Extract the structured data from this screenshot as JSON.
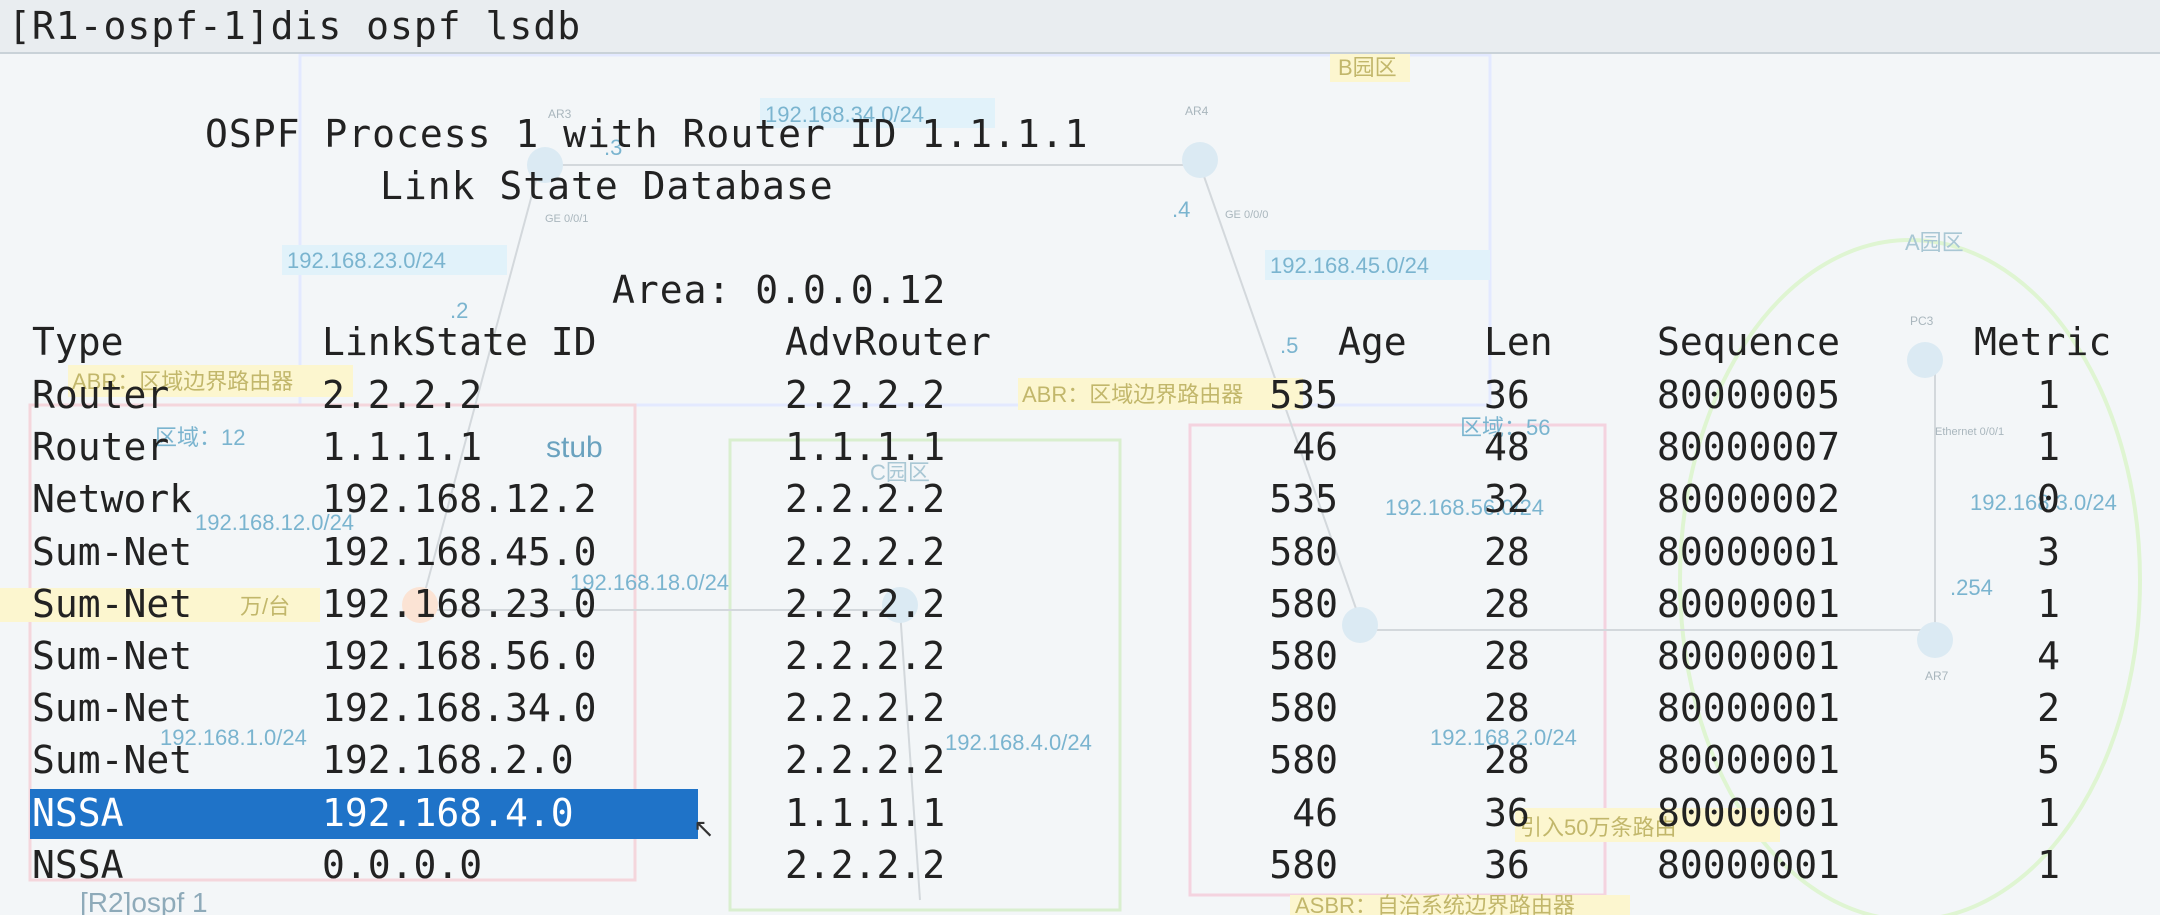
{
  "terminal": {
    "command": "[R1-ospf-1]dis ospf lsdb",
    "header_line1": "OSPF Process 1 with Router ID 1.1.1.1",
    "header_line2": "Link State Database",
    "area_line": "Area: 0.0.0.12"
  },
  "table": {
    "headers": {
      "type": "Type",
      "link_state_id": "LinkState ID",
      "adv_router": "AdvRouter",
      "age": "Age",
      "len": "Len",
      "sequence": "Sequence",
      "metric": "Metric"
    },
    "rows": [
      {
        "type": "Router",
        "lsid": "2.2.2.2",
        "adv": "2.2.2.2",
        "age": "535",
        "len": "36",
        "seq": "80000005",
        "metric": "1"
      },
      {
        "type": "Router",
        "lsid": "1.1.1.1",
        "adv": "1.1.1.1",
        "age": "46",
        "len": "48",
        "seq": "80000007",
        "metric": "1"
      },
      {
        "type": "Network",
        "lsid": "192.168.12.2",
        "adv": "2.2.2.2",
        "age": "535",
        "len": "32",
        "seq": "80000002",
        "metric": "0"
      },
      {
        "type": "Sum-Net",
        "lsid": "192.168.45.0",
        "adv": "2.2.2.2",
        "age": "580",
        "len": "28",
        "seq": "80000001",
        "metric": "3"
      },
      {
        "type": "Sum-Net",
        "lsid": "192.168.23.0",
        "adv": "2.2.2.2",
        "age": "580",
        "len": "28",
        "seq": "80000001",
        "metric": "1"
      },
      {
        "type": "Sum-Net",
        "lsid": "192.168.56.0",
        "adv": "2.2.2.2",
        "age": "580",
        "len": "28",
        "seq": "80000001",
        "metric": "4"
      },
      {
        "type": "Sum-Net",
        "lsid": "192.168.34.0",
        "adv": "2.2.2.2",
        "age": "580",
        "len": "28",
        "seq": "80000001",
        "metric": "2"
      },
      {
        "type": "Sum-Net",
        "lsid": "192.168.2.0",
        "adv": "2.2.2.2",
        "age": "580",
        "len": "28",
        "seq": "80000001",
        "metric": "5"
      },
      {
        "type": "NSSA",
        "lsid": "192.168.4.0",
        "adv": "1.1.1.1",
        "age": "46",
        "len": "36",
        "seq": "80000001",
        "metric": "1"
      },
      {
        "type": "NSSA",
        "lsid": "0.0.0.0",
        "adv": "2.2.2.2",
        "age": "580",
        "len": "36",
        "seq": "80000001",
        "metric": "1"
      }
    ],
    "selected_row_index": 8
  },
  "background_diagram": {
    "labels": [
      "AR3",
      "AR4",
      "192.168.34.0/24",
      "B园区",
      ".3",
      ".4",
      "GE 0/0/1",
      "GE 0/0/0",
      "192.168.23.0/24",
      "192.168.45.0/24",
      "A园区",
      ".2",
      ".5",
      "ABR：区域边界路由器",
      "ABR：区域边界路由器",
      "区域：12",
      "区域：56",
      "stub",
      "C园区",
      "192.168.12.0/24",
      "192.168.56.0/24",
      "192.168.18.0/24",
      "192.168.3.0/24",
      ".254",
      "万/台",
      "192.168.1.0/24",
      "192.168.4.0/24",
      "192.168.2.0/24",
      "引入50万条路由",
      "PC3",
      "AR7",
      "Ethernet 0/0/1",
      "[R2]ospf 1",
      "ASBR：自治系统边界路由器"
    ]
  },
  "colors": {
    "highlight": "#1f73c8",
    "terminal_text": "#222222",
    "diagram_label_bg": "#cfe9f7",
    "diagram_yellow": "#fbf3b8"
  }
}
